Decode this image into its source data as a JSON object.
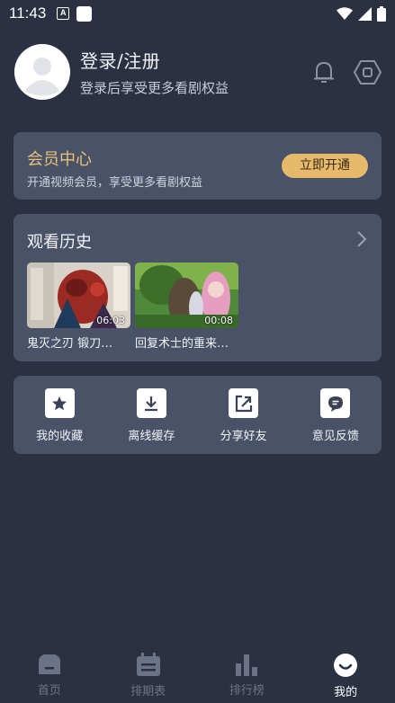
{
  "status_bar": {
    "time": "11:43",
    "app_icon_letter": "A"
  },
  "profile": {
    "name": "登录/注册",
    "subtitle": "登录后享受更多看剧权益"
  },
  "vip": {
    "title": "会员中心",
    "subtitle": "开通视频会员，享受更多看剧权益",
    "button_label": "立即开通",
    "accent_color": "#e6b96b"
  },
  "history": {
    "title": "观看历史",
    "items": [
      {
        "caption": "鬼灭之刃 锻刀…",
        "duration": "06:03"
      },
      {
        "caption": "回复术士的重来…",
        "duration": "00:08"
      }
    ]
  },
  "tools": [
    {
      "label": "我的收藏",
      "icon": "star-icon"
    },
    {
      "label": "离线缓存",
      "icon": "download-icon"
    },
    {
      "label": "分享好友",
      "icon": "share-icon"
    },
    {
      "label": "意见反馈",
      "icon": "feedback-icon"
    }
  ],
  "tabbar": {
    "tabs": [
      {
        "label": "首页",
        "icon": "home-icon",
        "active": false
      },
      {
        "label": "排期表",
        "icon": "calendar-icon",
        "active": false
      },
      {
        "label": "排行榜",
        "icon": "ranking-icon",
        "active": false
      },
      {
        "label": "我的",
        "icon": "profile-icon",
        "active": true
      }
    ]
  }
}
